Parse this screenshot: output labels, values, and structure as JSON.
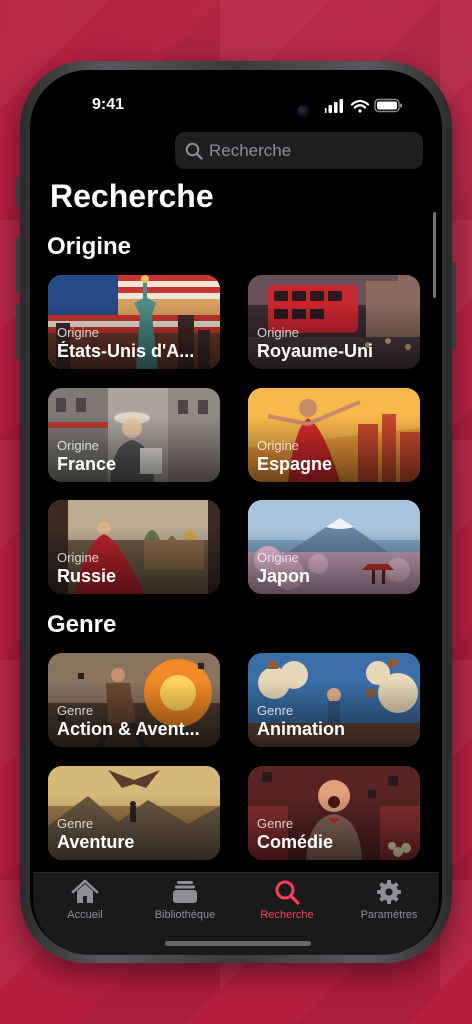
{
  "status_bar": {
    "time": "9:41",
    "icons": [
      "signal-icon",
      "wifi-icon",
      "battery-icon"
    ]
  },
  "search": {
    "placeholder": "Recherche",
    "icon": "search-icon"
  },
  "page_title": "Recherche",
  "sections": {
    "origin": {
      "title": "Origine",
      "cards": [
        {
          "subtitle": "Origine",
          "title": "États-Unis d'A..."
        },
        {
          "subtitle": "Origine",
          "title": "Royaume-Uni"
        },
        {
          "subtitle": "Origine",
          "title": "France"
        },
        {
          "subtitle": "Origine",
          "title": "Espagne"
        },
        {
          "subtitle": "Origine",
          "title": "Russie"
        },
        {
          "subtitle": "Origine",
          "title": "Japon"
        }
      ]
    },
    "genre": {
      "title": "Genre",
      "cards": [
        {
          "subtitle": "Genre",
          "title": "Action & Avent..."
        },
        {
          "subtitle": "Genre",
          "title": "Animation"
        },
        {
          "subtitle": "Genre",
          "title": "Aventure"
        },
        {
          "subtitle": "Genre",
          "title": "Comédie"
        }
      ]
    }
  },
  "tabbar": {
    "items": [
      {
        "label": "Accueil",
        "icon": "house-icon"
      },
      {
        "label": "Bibliothèque",
        "icon": "library-stack-icon"
      },
      {
        "label": "Recherche",
        "icon": "search-icon",
        "active": true
      },
      {
        "label": "Paramètres",
        "icon": "gear-icon"
      }
    ]
  },
  "colors": {
    "background": "#b41f3f",
    "accent": "#ff3b5c",
    "screen": "#000000",
    "search_field": "#1f1f22"
  }
}
